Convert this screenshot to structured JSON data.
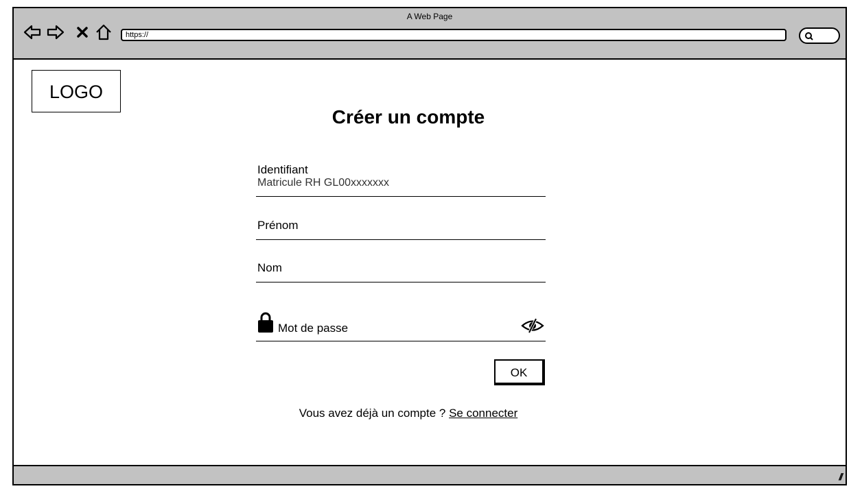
{
  "window": {
    "title": "A Web Page",
    "url": "https://"
  },
  "icons": {
    "back": "back-arrow-icon",
    "forward": "forward-arrow-icon",
    "stop": "close-icon",
    "home": "home-icon",
    "search": "search-icon",
    "lock": "lock-icon",
    "visibility": "eye-slash-icon"
  },
  "page": {
    "logo": "LOGO",
    "title": "Créer un compte",
    "fields": {
      "identifiant": {
        "label": "Identifiant",
        "placeholder": "Matricule RH GL00xxxxxxx"
      },
      "prenom": {
        "label": "Prénom"
      },
      "nom": {
        "label": "Nom"
      },
      "password": {
        "label": "Mot de passe"
      }
    },
    "ok_label": "OK",
    "footer": {
      "text": "Vous avez déjà un compte ?",
      "link": "Se connecter"
    }
  }
}
